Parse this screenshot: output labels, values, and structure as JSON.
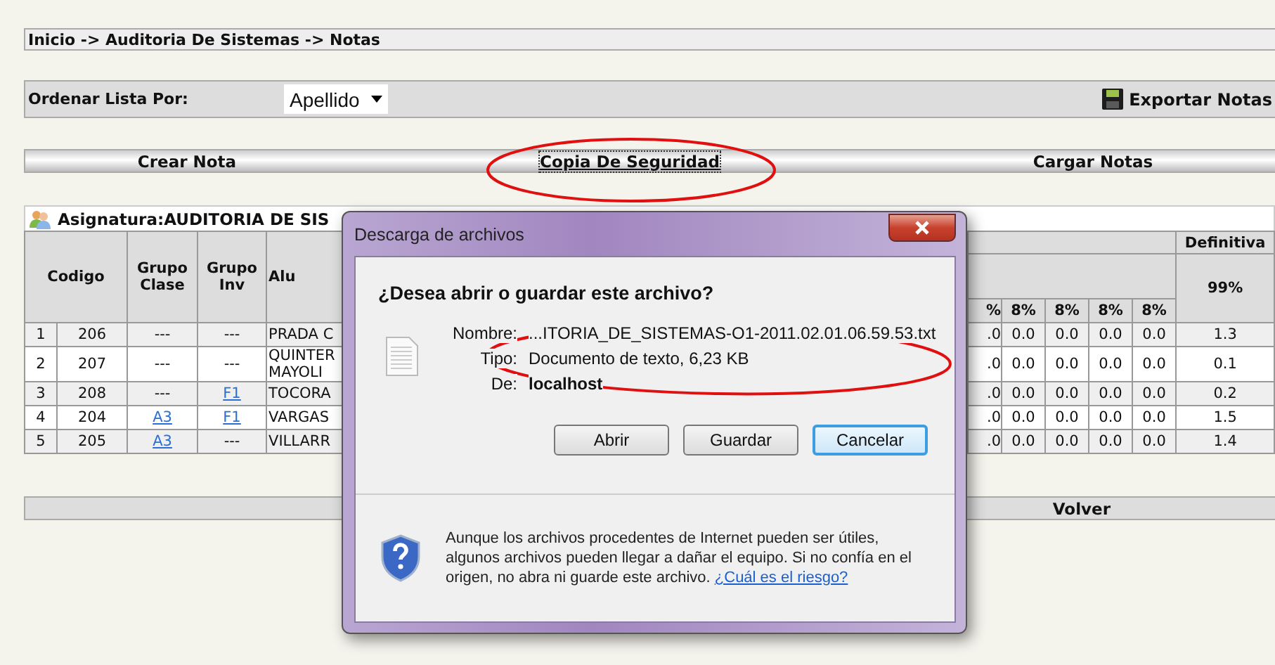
{
  "breadcrumb": "Inicio -> Auditoria De Sistemas -> Notas",
  "sort": {
    "label": "Ordenar Lista Por:",
    "value": "Apellido"
  },
  "export": {
    "label": "Exportar Notas"
  },
  "actions": [
    {
      "label": "Crear Nota",
      "focused": false
    },
    {
      "label": "Copia De Seguridad",
      "focused": true
    },
    {
      "label": "Cargar Notas",
      "focused": false
    }
  ],
  "subject": {
    "title": "Asignatura:AUDITORIA DE SIS"
  },
  "table": {
    "columns": [
      "Codigo",
      "Grupo Clase",
      "Grupo Inv",
      "Alu"
    ],
    "final_header": "Definitiva",
    "final_weight": "99%",
    "grade_headers": [
      "%",
      "8%",
      "8%",
      "8%",
      "8%"
    ],
    "rows": [
      {
        "index": "1",
        "codigo": "206",
        "grupo_clase": {
          "text": "---",
          "link": false
        },
        "grupo_inv": {
          "text": "---",
          "link": false
        },
        "alumno": [
          "PRADA C"
        ],
        "grades": [
          ".0",
          "0.0",
          "0.0",
          "0.0",
          "0.0"
        ],
        "definitiva": "1.3"
      },
      {
        "index": "2",
        "codigo": "207",
        "grupo_clase": {
          "text": "---",
          "link": false
        },
        "grupo_inv": {
          "text": "---",
          "link": false
        },
        "alumno": [
          "QUINTER",
          "MAYOLI"
        ],
        "grades": [
          ".0",
          "0.0",
          "0.0",
          "0.0",
          "0.0"
        ],
        "definitiva": "0.1"
      },
      {
        "index": "3",
        "codigo": "208",
        "grupo_clase": {
          "text": "---",
          "link": false
        },
        "grupo_inv": {
          "text": "F1",
          "link": true
        },
        "alumno": [
          "TOCORA"
        ],
        "grades": [
          ".0",
          "0.0",
          "0.0",
          "0.0",
          "0.0"
        ],
        "definitiva": "0.2"
      },
      {
        "index": "4",
        "codigo": "204",
        "grupo_clase": {
          "text": "A3",
          "link": true
        },
        "grupo_inv": {
          "text": "F1",
          "link": true
        },
        "alumno": [
          "VARGAS"
        ],
        "grades": [
          ".0",
          "0.0",
          "0.0",
          "0.0",
          "0.0"
        ],
        "definitiva": "1.5"
      },
      {
        "index": "5",
        "codigo": "205",
        "grupo_clase": {
          "text": "A3",
          "link": true
        },
        "grupo_inv": {
          "text": "---",
          "link": false
        },
        "alumno": [
          "VILLARR"
        ],
        "grades": [
          ".0",
          "0.0",
          "0.0",
          "0.0",
          "0.0"
        ],
        "definitiva": "1.4"
      }
    ]
  },
  "back": {
    "label": "Volver"
  },
  "dialog": {
    "title": "Descarga de archivos",
    "question": "¿Desea abrir o guardar este archivo?",
    "fields": [
      {
        "label": "Nombre:",
        "value": "...ITORIA_DE_SISTEMAS-O1-2011.02.01.06.59.53.txt",
        "bold": false
      },
      {
        "label": "Tipo:",
        "value": "Documento de texto, 6,23 KB",
        "bold": false
      },
      {
        "label": "De:",
        "value": "localhost",
        "bold": true
      }
    ],
    "buttons": [
      {
        "label": "Abrir",
        "focused": false
      },
      {
        "label": "Guardar",
        "focused": false
      },
      {
        "label": "Cancelar",
        "focused": true
      }
    ],
    "warning": "Aunque los archivos procedentes de Internet pueden ser útiles, algunos archivos pueden llegar a dañar el equipo. Si no confía en el origen, no abra ni guarde este archivo.",
    "warning_link": "¿Cuál es el riesgo?"
  }
}
